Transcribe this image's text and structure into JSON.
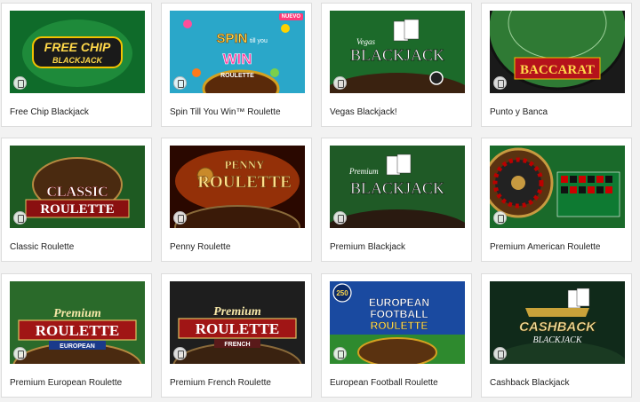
{
  "games": [
    {
      "title": "Free Chip Blackjack",
      "art": [
        "FREE CHIP",
        "BLACKJACK"
      ],
      "icon": "mobile-device-icon"
    },
    {
      "title": "Spin Till You Win™ Roulette",
      "art": [
        "SPIN",
        "till you",
        "WIN",
        "ROULETTE"
      ],
      "badge": "NUEVO",
      "icon": "mobile-device-icon"
    },
    {
      "title": "Vegas Blackjack!",
      "art": [
        "Vegas",
        "BLACKJACK"
      ],
      "icon": "mobile-device-icon"
    },
    {
      "title": "Punto y Banca",
      "art": [
        "BACCARAT"
      ],
      "icon": "mobile-device-icon"
    },
    {
      "title": "Classic Roulette",
      "art": [
        "CLASSIC",
        "ROULETTE"
      ],
      "icon": "mobile-device-icon"
    },
    {
      "title": "Penny Roulette",
      "art": [
        "PENNY",
        "ROULETTE"
      ],
      "icon": "mobile-device-icon"
    },
    {
      "title": "Premium Blackjack",
      "art": [
        "Premium",
        "BLACKJACK"
      ],
      "icon": "mobile-device-icon"
    },
    {
      "title": "Premium American Roulette",
      "art": [],
      "icon": "mobile-device-icon"
    },
    {
      "title": "Premium European Roulette",
      "art": [
        "Premium",
        "ROULETTE",
        "EUROPEAN"
      ],
      "icon": "mobile-device-icon"
    },
    {
      "title": "Premium French Roulette",
      "art": [
        "Premium",
        "ROULETTE",
        "FRENCH"
      ],
      "icon": "mobile-device-icon"
    },
    {
      "title": "European Football Roulette",
      "art": [
        "EUROPEAN",
        "FOOTBALL",
        "ROULETTE",
        "250"
      ],
      "icon": "mobile-device-icon"
    },
    {
      "title": "Cashback Blackjack",
      "art": [
        "CASHBACK",
        "BLACKJACK"
      ],
      "icon": "mobile-device-icon"
    }
  ]
}
